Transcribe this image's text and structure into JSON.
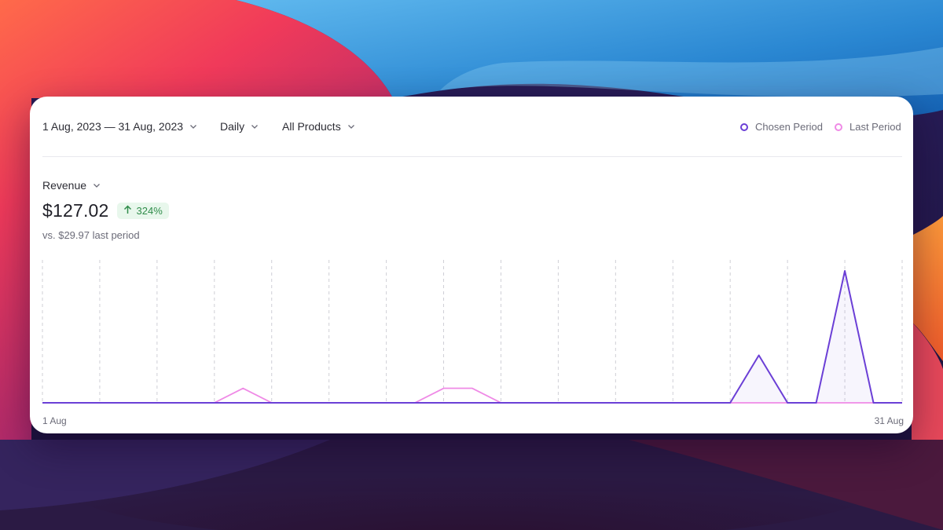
{
  "toolbar": {
    "date_range": "1 Aug, 2023 — 31 Aug, 2023",
    "interval": "Daily",
    "product_filter": "All Products"
  },
  "legend": [
    {
      "label": "Chosen Period",
      "color": "#6b3fd6"
    },
    {
      "label": "Last Period",
      "color": "#ef8ae6"
    }
  ],
  "metric": {
    "name": "Revenue",
    "value": "$127.02",
    "change": "324%",
    "change_direction": "up",
    "comparison": "vs. $29.97 last period"
  },
  "colors": {
    "chosen": "#6b3fd6",
    "last": "#ef8ae6",
    "badge_bg": "#e8f7ec",
    "badge_text": "#2f8c4a"
  },
  "chart_data": {
    "type": "area",
    "x_start_label": "1 Aug",
    "x_end_label": "31 Aug",
    "grid": "vertical-dashed",
    "series": [
      {
        "name": "Chosen Period",
        "values": [
          0,
          0,
          0,
          0,
          0,
          0,
          0,
          0,
          0,
          0,
          0,
          0,
          0,
          0,
          0,
          0,
          0,
          0,
          0,
          0,
          0,
          0,
          0,
          0,
          0,
          0.36,
          0,
          0,
          1,
          0,
          0
        ]
      },
      {
        "name": "Last Period",
        "values": [
          0,
          0,
          0,
          0,
          0,
          0,
          0,
          0.11,
          0,
          0,
          0,
          0,
          0,
          0,
          0.11,
          0.11,
          0,
          0,
          0,
          0,
          0,
          0,
          0,
          0,
          0,
          0,
          0,
          0,
          0,
          0,
          0
        ]
      }
    ]
  }
}
